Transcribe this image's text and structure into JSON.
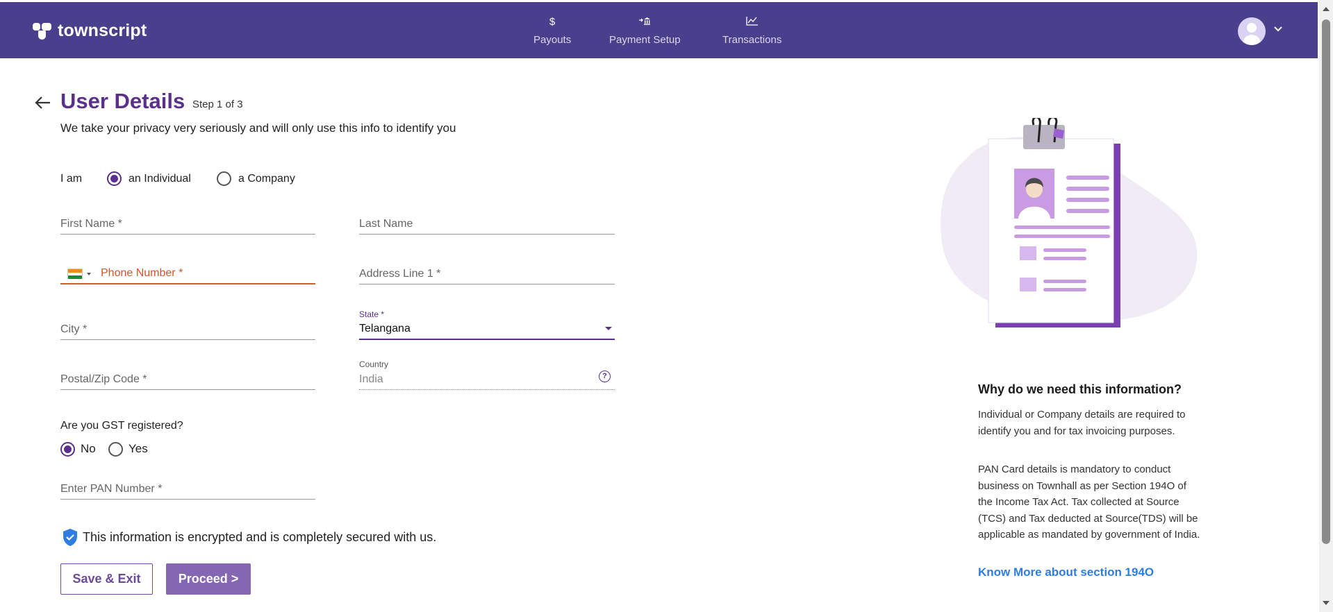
{
  "header": {
    "brand": "townscript",
    "nav": [
      {
        "icon": "$",
        "label": "Payouts"
      },
      {
        "icon": "⇢",
        "label": "Payment Setup"
      },
      {
        "icon": "↗",
        "label": "Transactions"
      }
    ],
    "colors": {
      "bar": "#4a3f8c"
    }
  },
  "page": {
    "title": "User Details",
    "step": "Step 1 of 3",
    "subtitle": "We take your privacy very seriously and will only use this info to identify you"
  },
  "entity": {
    "label": "I am",
    "options": [
      "an Individual",
      "a Company"
    ],
    "selected": "an Individual"
  },
  "form": {
    "first_name": "First Name *",
    "last_name": "Last Name",
    "phone": "Phone Number *",
    "address1": "Address Line 1 *",
    "city": "City *",
    "state_label": "State *",
    "state_value": "Telangana",
    "postal": "Postal/Zip Code *",
    "country_label": "Country",
    "country_value": "India",
    "gst_question": "Are you GST registered?",
    "gst_options": [
      "No",
      "Yes"
    ],
    "gst_selected": "No",
    "pan": "Enter PAN Number *"
  },
  "secure_note": "This information is encrypted and is completely secured with us.",
  "buttons": {
    "save_exit": "Save & Exit",
    "proceed": "Proceed >"
  },
  "info": {
    "title": "Why do we need this information?",
    "para1": "Individual or Company details are required to identify you and for tax invoicing purposes.",
    "para2": "PAN Card details is mandatory to conduct business on Townhall as per Section 194O of the Income Tax Act. Tax collected at Source (TCS) and Tax deducted at Source(TDS) will be applicable as mandated by government of India.",
    "link": "Know More about section 194O"
  },
  "theme": {
    "accent": "#5b2f8c",
    "link": "#2f7de0",
    "error": "#d8532b"
  }
}
